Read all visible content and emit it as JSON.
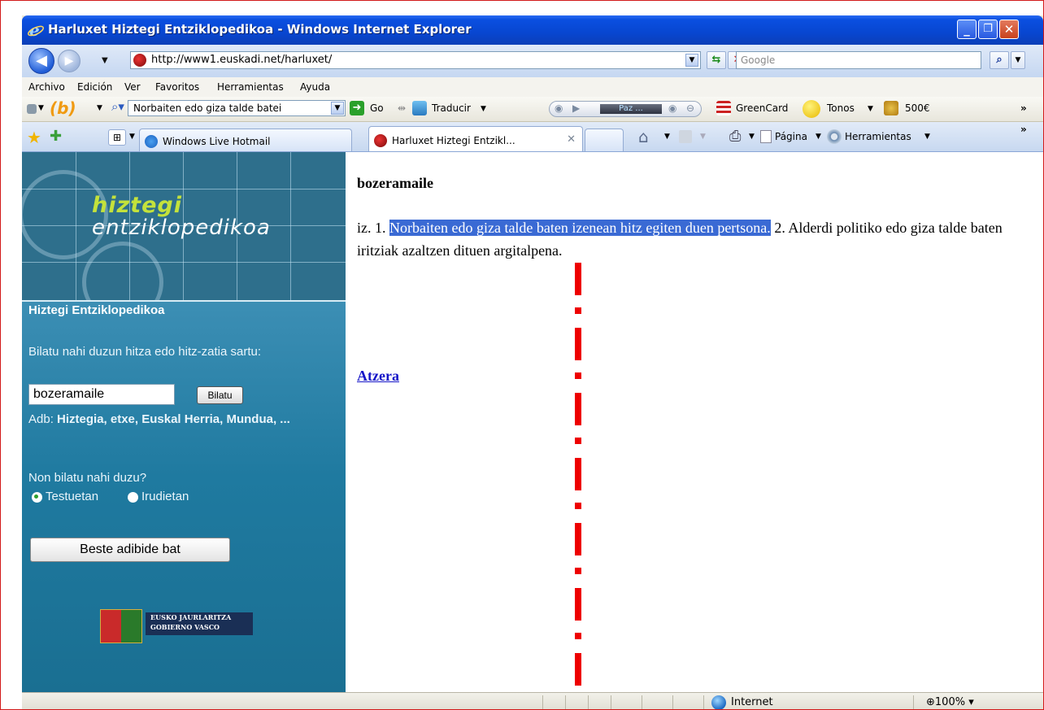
{
  "window": {
    "title": "Harluxet Hiztegi Entziklopedikoa - Windows Internet Explorer",
    "minimize": "_",
    "maximize": "❐",
    "close": "✕"
  },
  "address": {
    "url": "http://www1.euskadi.net/harluxet/",
    "search_placeholder": "Google"
  },
  "menu": [
    "Archivo",
    "Edición",
    "Ver",
    "Favoritos",
    "Herramientas",
    "Ayuda"
  ],
  "toolbar": {
    "search_value": "Norbaiten edo giza talde batei",
    "go_label": "Go",
    "translate_label": "Traducir",
    "player_label": "Paz ...",
    "greencard_label": "GreenCard",
    "tonos_label": "Tonos",
    "price_label": "500€",
    "more": "»"
  },
  "tabs": [
    {
      "label": "Windows Live Hotmail"
    },
    {
      "label": "Harluxet Hiztegi Entzikl..."
    }
  ],
  "command_bar": {
    "page_label": "Página",
    "tools_label": "Herramientas",
    "more": "»"
  },
  "sidebar": {
    "logo_line1": "hiztegi",
    "logo_line2": "entziklopedikoa",
    "heading": "Hiztegi Entziklopedikoa",
    "prompt": "Bilatu nahi duzun hitza edo hitz-zatia sartu:",
    "search_value": "bozeramaile",
    "search_button": "Bilatu",
    "example_prefix": "Adb: ",
    "example_bold": "Hiztegia, etxe, Euskal Herria, Mundua, ...",
    "scope_question": "Non bilatu nahi duzu?",
    "radio_texts": "Testuetan",
    "radio_images": "Irudietan",
    "another_example_button": "Beste adibide bat",
    "gov_line1": "EUSKO JAURLARITZA",
    "gov_line2": "GOBIERNO VASCO"
  },
  "main": {
    "headword": "bozeramaile",
    "def_prefix": "iz. 1. ",
    "def_highlight": "Norbaiten edo giza talde baten izenean hitz egiten duen pertsona.",
    "def_rest": " 2. Alderdi politiko edo giza talde baten iritziak azaltzen dituen argitalpena.",
    "back_link": "Atzera"
  },
  "status": {
    "zone": "Internet",
    "zoom": "100%"
  }
}
